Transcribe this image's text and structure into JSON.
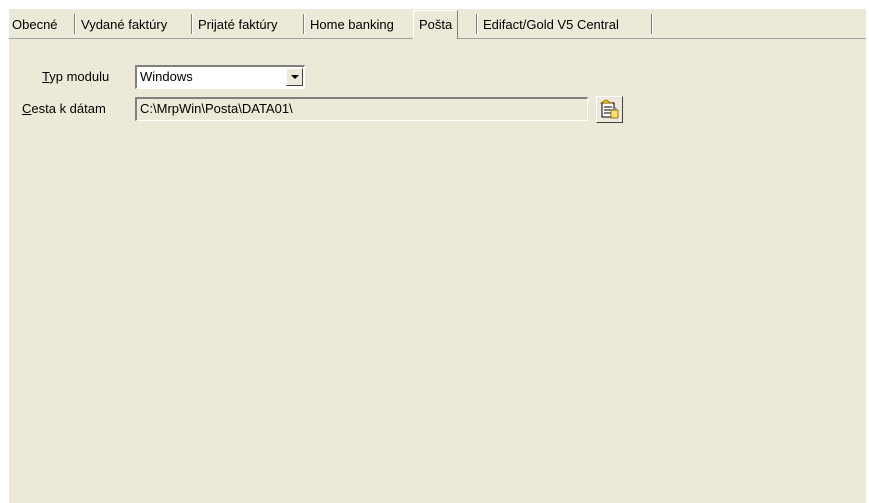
{
  "tabs": [
    {
      "label": "Obecné",
      "active": false
    },
    {
      "label": "Vydané faktúry",
      "active": false
    },
    {
      "label": "Prijaté faktúry",
      "active": false
    },
    {
      "label": "Home banking",
      "active": false
    },
    {
      "label": "Pošta",
      "active": true
    },
    {
      "label": "Edifact/Gold V5 Central",
      "active": false
    }
  ],
  "form": {
    "module_type": {
      "label_mnemonic": "T",
      "label_rest": "yp modulu",
      "value": "Windows"
    },
    "data_path": {
      "label_mnemonic": "C",
      "label_rest": "esta k dátam",
      "value": "C:\\MrpWin\\Posta\\DATA01\\"
    }
  },
  "icons": {
    "combo_arrow": "chevron-down-icon",
    "browse": "browse-folder-icon"
  }
}
